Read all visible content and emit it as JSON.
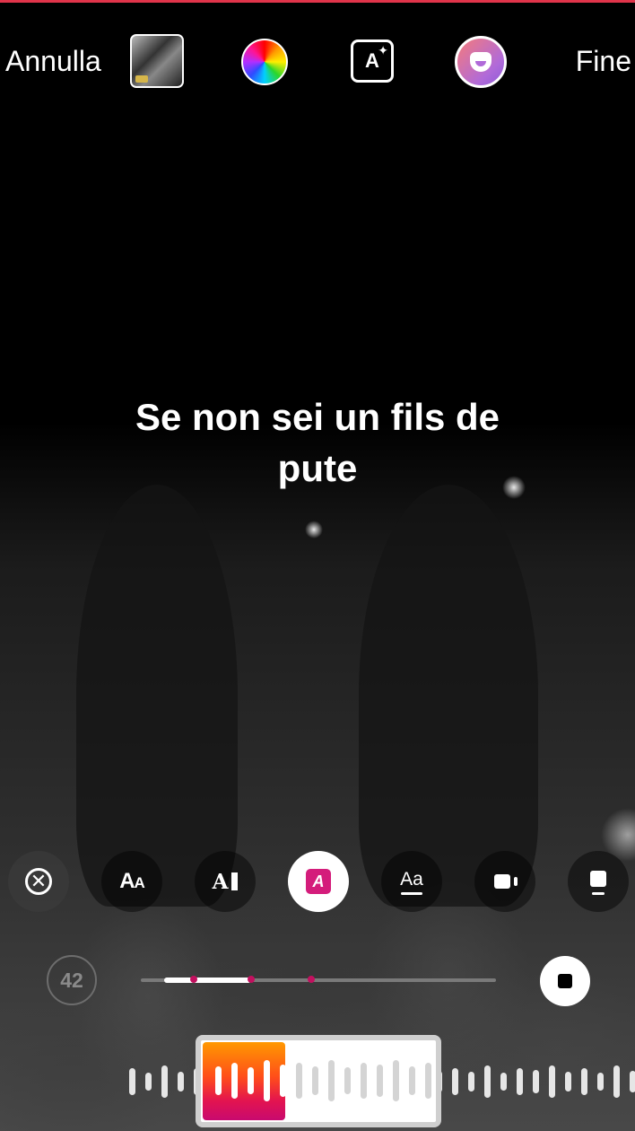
{
  "topbar": {
    "cancel_label": "Annulla",
    "done_label": "Fine",
    "items": [
      "media-thumbnail",
      "color-wheel-icon",
      "text-effects-icon",
      "sticker-icon"
    ]
  },
  "caption": {
    "text": "Se non sei un fils de pute"
  },
  "text_styles": {
    "items": [
      {
        "name": "close-icon",
        "glyph": "✕"
      },
      {
        "name": "style-classic",
        "glyph_big": "A",
        "glyph_small": "A"
      },
      {
        "name": "style-typewriter",
        "glyph": "A"
      },
      {
        "name": "style-highlight",
        "glyph": "A",
        "selected": true
      },
      {
        "name": "style-underline",
        "glyph": "Aa"
      },
      {
        "name": "style-background-camera"
      },
      {
        "name": "style-box"
      }
    ]
  },
  "player": {
    "font_size_value": "42",
    "progress": 0.31,
    "markers": [
      0.15,
      0.31,
      0.48
    ]
  },
  "colors": {
    "accent_pink": "#d41c7b",
    "marker": "#c3105f",
    "top_strip": "#e0344a",
    "waveform_gradient": [
      "#ff9900",
      "#ff4d1a",
      "#e3144f",
      "#c80a6f"
    ]
  }
}
